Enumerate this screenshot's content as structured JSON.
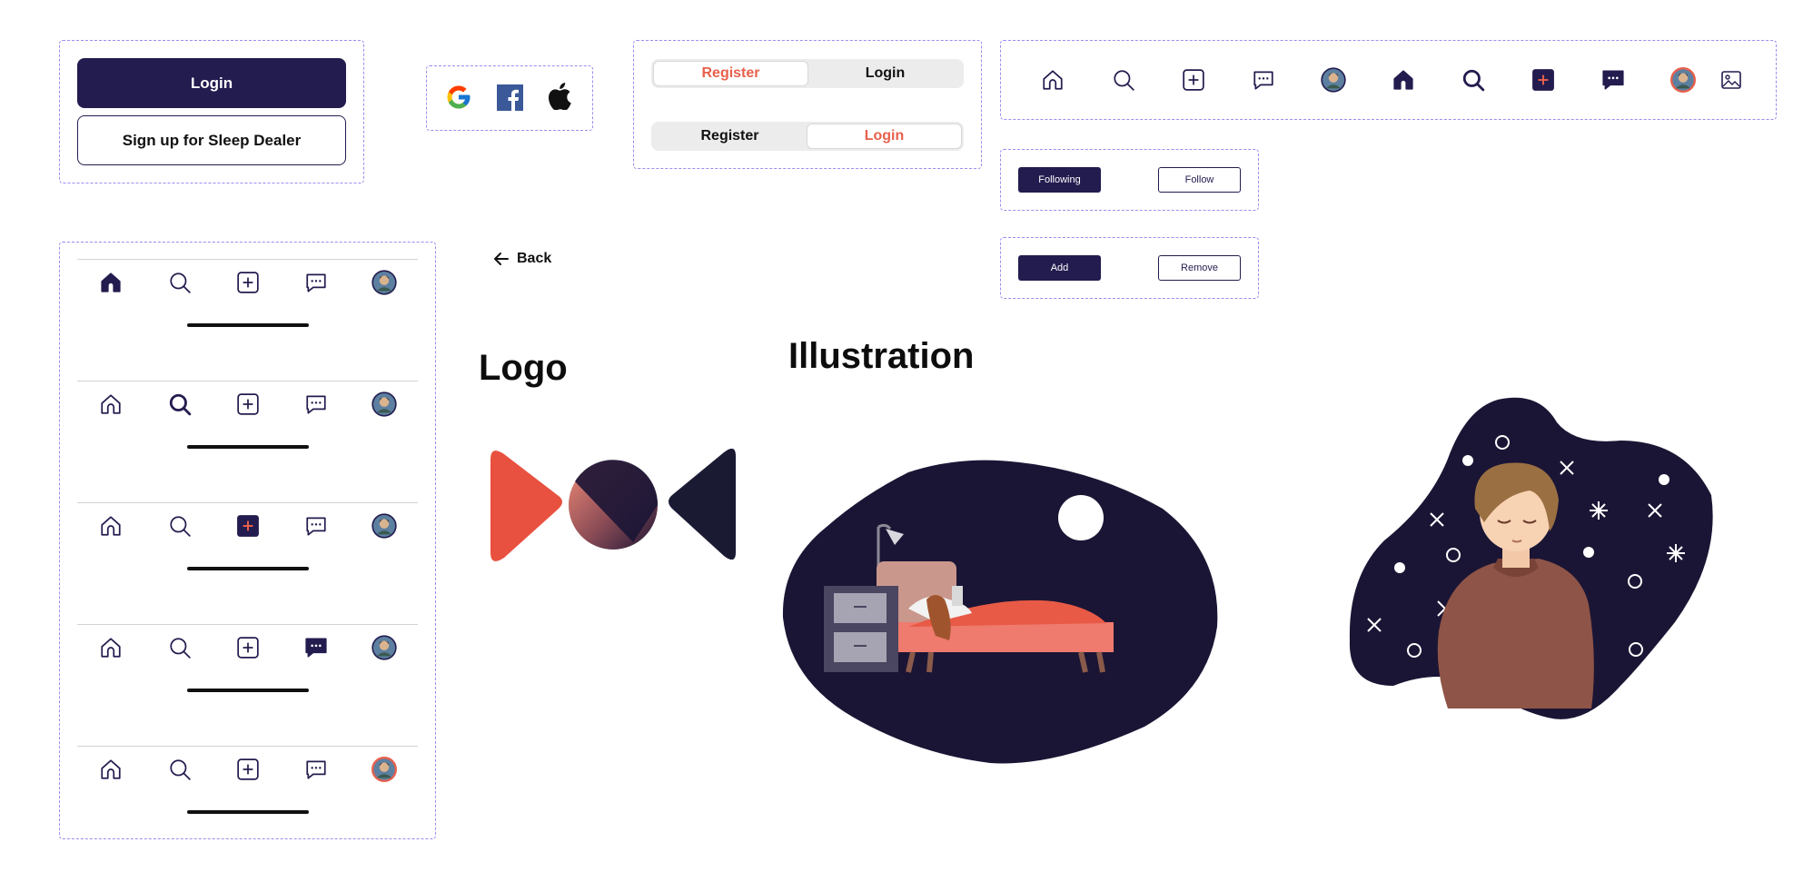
{
  "auth": {
    "login_label": "Login",
    "signup_label": "Sign up for Sleep Dealer"
  },
  "social": {
    "providers": [
      "google-icon",
      "facebook-icon",
      "apple-icon"
    ]
  },
  "toggles": {
    "register_label": "Register",
    "login_label": "Login"
  },
  "follow": {
    "following_label": "Following",
    "follow_label": "Follow"
  },
  "addremove": {
    "add_label": "Add",
    "remove_label": "Remove"
  },
  "back": {
    "label": "Back"
  },
  "sections": {
    "logo_title": "Logo",
    "illustration_title": "Illustration"
  },
  "colors": {
    "primary": "#231c4f",
    "accent": "#e8604c",
    "border_dashed": "#9b8cf0"
  },
  "navbar_variants": {
    "active_items": [
      "home",
      "search",
      "add",
      "messages",
      "profile"
    ]
  }
}
